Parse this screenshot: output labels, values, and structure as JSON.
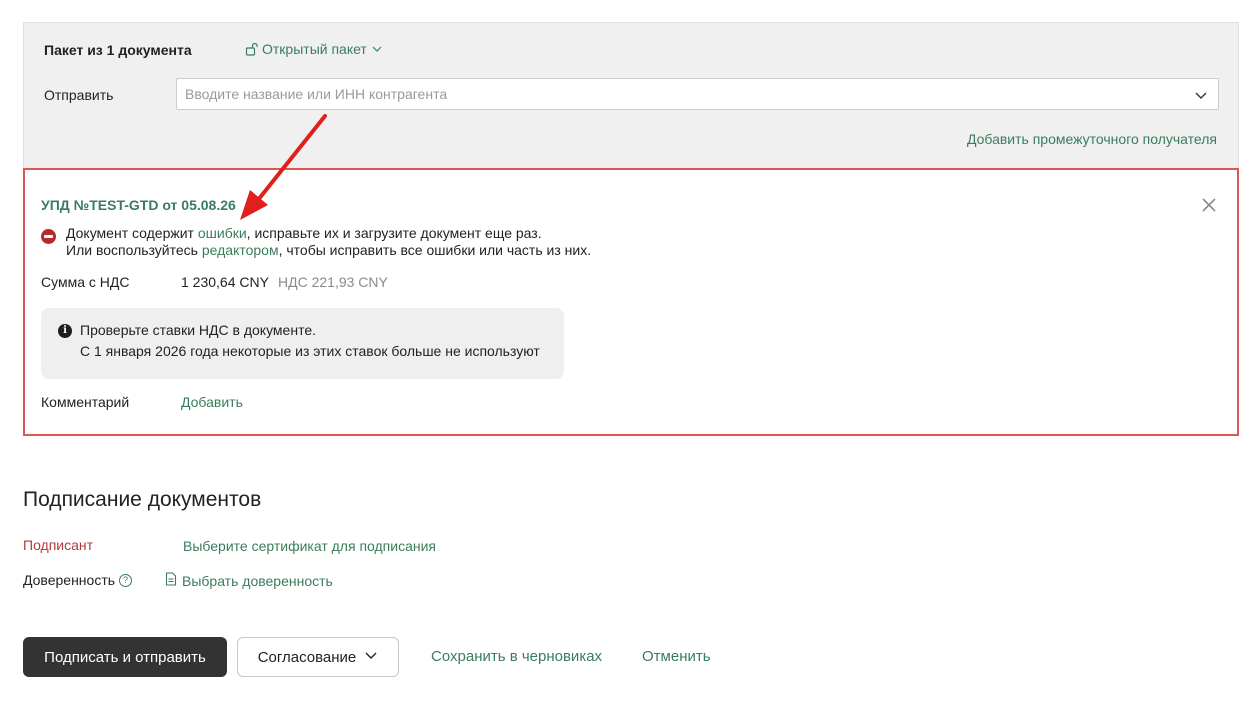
{
  "packet": {
    "title": "Пакет из 1 документа",
    "type_label": "Открытый пакет",
    "send_label": "Отправить",
    "send_placeholder": "Вводите название или ИНН контрагента",
    "add_intermediate": "Добавить промежуточного получателя"
  },
  "document": {
    "title": "УПД №TEST-GTD от 05.08.26",
    "error_prefix": "Документ содержит ",
    "error_link": "ошибки",
    "error_suffix": ", исправьте их и загрузите документ еще раз.",
    "error2_prefix": "Или воспользуйтесь ",
    "error2_link": "редактором",
    "error2_suffix": ", чтобы исправить все ошибки или часть из них.",
    "sum_label": "Сумма с НДС",
    "sum_value": "1 230,64 CNY",
    "vat_value": "НДС 221,93 CNY",
    "info_line1": "Проверьте ставки НДС в документе.",
    "info_line2": "С 1 января 2026 года некоторые из этих ставок больше не используют",
    "comment_label": "Комментарий",
    "comment_add": "Добавить"
  },
  "signing": {
    "heading": "Подписание документов",
    "signer_label": "Подписант",
    "signer_link": "Выберите сертификат для подписания",
    "poa_label": "Доверенность",
    "poa_link": "Выбрать доверенность"
  },
  "actions": {
    "sign_send": "Подписать и отправить",
    "approval": "Согласование",
    "save_draft": "Сохранить в черновиках",
    "cancel": "Отменить"
  },
  "colors": {
    "accent_green": "#3a7d5c",
    "error_red": "#e05454",
    "annotation_arrow": "#e0201c",
    "primary_button": "#333333"
  },
  "icons": [
    "unlock-icon",
    "chevron-down-icon",
    "close-icon",
    "error-icon",
    "info-icon",
    "help-icon",
    "document-icon"
  ]
}
